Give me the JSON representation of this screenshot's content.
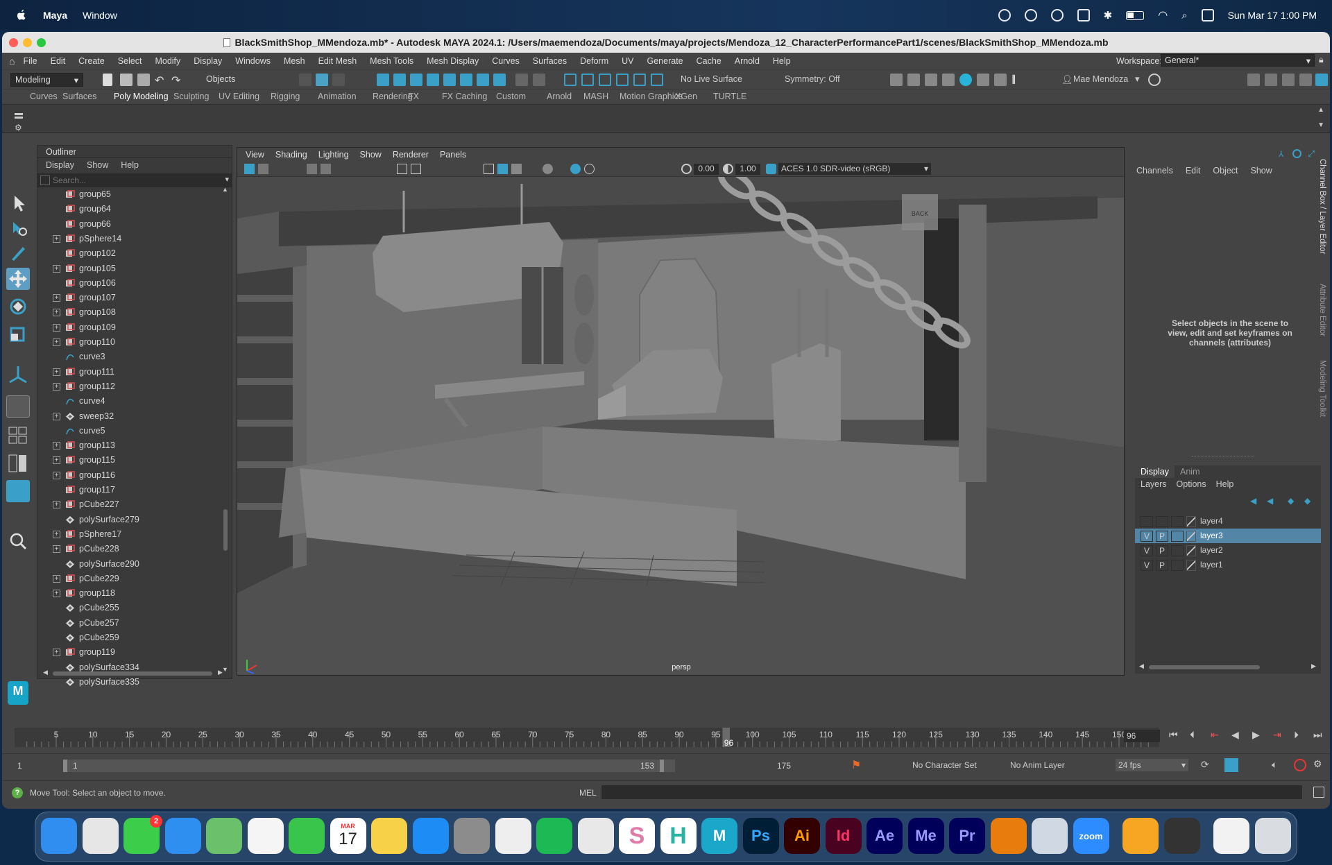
{
  "mac_menubar": {
    "app_name": "Maya",
    "menu": "Window",
    "datetime": "Sun Mar 17  1:00 PM"
  },
  "window": {
    "title": "BlackSmithShop_MMendoza.mb* - Autodesk MAYA 2024.1: /Users/maemendoza/Documents/maya/projects/Mendoza_12_CharacterPerformancePart1/scenes/BlackSmithShop_MMendoza.mb"
  },
  "main_menu": [
    "File",
    "Edit",
    "Create",
    "Select",
    "Modify",
    "Display",
    "Windows",
    "Mesh",
    "Edit Mesh",
    "Mesh Tools",
    "Mesh Display",
    "Curves",
    "Surfaces",
    "Deform",
    "UV",
    "Generate",
    "Cache",
    "Arnold",
    "Help"
  ],
  "workspace": {
    "label": "Workspace:",
    "value": "General*"
  },
  "toolbar": {
    "mode": "Modeling",
    "objects": "Objects",
    "live_surface": "No Live Surface",
    "symmetry": "Symmetry: Off",
    "user": "Mae Mendoza"
  },
  "shelf_tabs": [
    "Curves",
    "Surfaces",
    "Poly Modeling",
    "Sculpting",
    "UV Editing",
    "Rigging",
    "Animation",
    "Rendering",
    "FX",
    "FX Caching",
    "Custom",
    "Arnold",
    "MASH",
    "Motion Graphics",
    "XGen",
    "TURTLE"
  ],
  "active_shelf_tab": "Poly Modeling",
  "outliner": {
    "title": "Outliner",
    "menu": [
      "Display",
      "Show",
      "Help"
    ],
    "search_placeholder": "Search...",
    "items": [
      {
        "name": "group65",
        "expand": false,
        "type": "group"
      },
      {
        "name": "group64",
        "expand": false,
        "type": "group"
      },
      {
        "name": "group66",
        "expand": false,
        "type": "group"
      },
      {
        "name": "pSphere14",
        "expand": true,
        "type": "group"
      },
      {
        "name": "group102",
        "expand": false,
        "type": "group"
      },
      {
        "name": "group105",
        "expand": true,
        "type": "group"
      },
      {
        "name": "group106",
        "expand": false,
        "type": "group"
      },
      {
        "name": "group107",
        "expand": true,
        "type": "group"
      },
      {
        "name": "group108",
        "expand": true,
        "type": "group"
      },
      {
        "name": "group109",
        "expand": true,
        "type": "group"
      },
      {
        "name": "group110",
        "expand": true,
        "type": "group"
      },
      {
        "name": "curve3",
        "expand": false,
        "type": "curve"
      },
      {
        "name": "group111",
        "expand": true,
        "type": "group"
      },
      {
        "name": "group112",
        "expand": true,
        "type": "group"
      },
      {
        "name": "curve4",
        "expand": false,
        "type": "curve"
      },
      {
        "name": "sweep32",
        "expand": true,
        "type": "mesh"
      },
      {
        "name": "curve5",
        "expand": false,
        "type": "curve"
      },
      {
        "name": "group113",
        "expand": true,
        "type": "group"
      },
      {
        "name": "group115",
        "expand": true,
        "type": "group"
      },
      {
        "name": "group116",
        "expand": true,
        "type": "group"
      },
      {
        "name": "group117",
        "expand": false,
        "type": "group"
      },
      {
        "name": "pCube227",
        "expand": true,
        "type": "group"
      },
      {
        "name": "polySurface279",
        "expand": false,
        "type": "mesh"
      },
      {
        "name": "pSphere17",
        "expand": true,
        "type": "group"
      },
      {
        "name": "pCube228",
        "expand": true,
        "type": "group"
      },
      {
        "name": "polySurface290",
        "expand": false,
        "type": "mesh"
      },
      {
        "name": "pCube229",
        "expand": true,
        "type": "group"
      },
      {
        "name": "group118",
        "expand": true,
        "type": "group"
      },
      {
        "name": "pCube255",
        "expand": false,
        "type": "mesh"
      },
      {
        "name": "pCube257",
        "expand": false,
        "type": "mesh"
      },
      {
        "name": "pCube259",
        "expand": false,
        "type": "mesh"
      },
      {
        "name": "group119",
        "expand": true,
        "type": "group"
      },
      {
        "name": "polySurface334",
        "expand": false,
        "type": "mesh"
      },
      {
        "name": "polySurface335",
        "expand": false,
        "type": "mesh"
      }
    ]
  },
  "viewport": {
    "menu": [
      "View",
      "Shading",
      "Lighting",
      "Show",
      "Renderer",
      "Panels"
    ],
    "value_a": "0.00",
    "value_b": "1.00",
    "color_space": "ACES 1.0 SDR-video (sRGB)",
    "camera_label": "persp",
    "viewcube_label": "BACK"
  },
  "channel_box": {
    "menu": [
      "Channels",
      "Edit",
      "Object",
      "Show"
    ],
    "hint": "Select objects in the scene to view, edit and set keyframes on channels (attributes)",
    "side_tabs": [
      "Channel Box / Layer Editor",
      "Attribute Editor",
      "Modeling Toolkit"
    ]
  },
  "layer_editor": {
    "tabs": [
      "Display",
      "Anim"
    ],
    "menu": [
      "Layers",
      "Options",
      "Help"
    ],
    "layers": [
      {
        "v": "",
        "p": "",
        "name": "layer4",
        "selected": false
      },
      {
        "v": "V",
        "p": "P",
        "name": "layer3",
        "selected": true
      },
      {
        "v": "V",
        "p": "P",
        "name": "layer2",
        "selected": false
      },
      {
        "v": "V",
        "p": "P",
        "name": "layer1",
        "selected": false
      }
    ]
  },
  "timeline": {
    "ticks": [
      "5",
      "10",
      "15",
      "20",
      "25",
      "30",
      "35",
      "40",
      "45",
      "50",
      "55",
      "60",
      "65",
      "70",
      "75",
      "80",
      "85",
      "90",
      "95",
      "100",
      "105",
      "110",
      "115",
      "120",
      "125",
      "130",
      "135",
      "140",
      "145",
      "150"
    ],
    "tick_start": 5,
    "tick_end": 150,
    "current_frame": "96",
    "current_frame_field": "96"
  },
  "range": {
    "start": "1",
    "range_start": "1",
    "range_end": "153",
    "end": "175",
    "character_set": "No Character Set",
    "anim_layer": "No Anim Layer",
    "fps": "24 fps"
  },
  "help_line": "Move Tool: Select an object to move.",
  "mel_label": "MEL",
  "dock": [
    "finder",
    "launchpad",
    "messages",
    "mail",
    "maps",
    "photos",
    "facetime",
    "calendar",
    "notes",
    "app-store",
    "system-settings",
    "chrome",
    "spotify",
    "1password",
    "s-app",
    "h-app",
    "maya",
    "photoshop",
    "illustrator",
    "indesign",
    "after-effects",
    "media-encoder",
    "premiere",
    "blender",
    "preview",
    "zoom",
    "pages",
    "activity-monitor",
    "textedit",
    "trash"
  ],
  "dock_labels": {
    "calendar_month": "MAR",
    "calendar_day": "17",
    "messages_badge": "2",
    "zoom": "zoom",
    "ps": "Ps",
    "ai": "Ai",
    "id": "Id",
    "ae": "Ae",
    "me": "Me",
    "pr": "Pr",
    "maya": "M",
    "s": "S",
    "h": "H"
  }
}
